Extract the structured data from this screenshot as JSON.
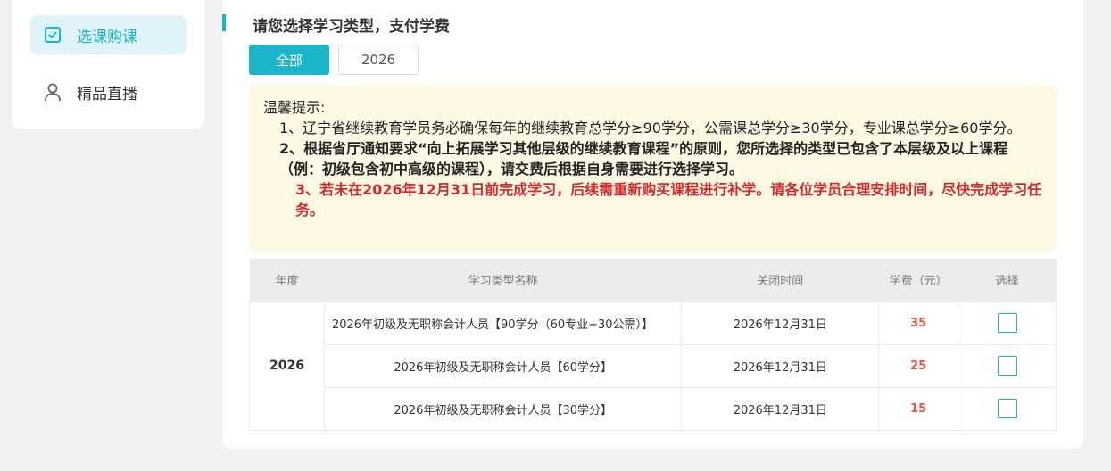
{
  "sidebar": {
    "items": [
      {
        "label": "选课购课",
        "icon": "checkbox-icon",
        "active": true
      },
      {
        "label": "精品直播",
        "icon": "user-icon",
        "active": false
      }
    ]
  },
  "main": {
    "title": "请您选择学习类型，支付学费",
    "tabs": [
      {
        "label": "全部",
        "active": true
      },
      {
        "label": "2026",
        "active": false
      }
    ],
    "notice": {
      "heading": "温馨提示:",
      "line1": "1、辽宁省继续教育学员务必确保每年的继续教育总学分≥90学分，公需课总学分≥30学分，专业课总学分≥60学分。",
      "line2": "2、根据省厅通知要求“向上拓展学习其他层级的继续教育课程”的原则，您所选择的类型已包含了本层级及以上课程（例：初级包含初中高级的课程），请交费后根据自身需要进行选择学习。",
      "line3": "3、若未在2026年12月31日前完成学习，后续需重新购买课程进行补学。请各位学员合理安排时间，尽快完成学习任务。"
    },
    "table": {
      "headers": [
        "年度",
        "学习类型名称",
        "关闭时间",
        "学费（元）",
        "选择"
      ],
      "year": "2026",
      "rows": [
        {
          "name": "2026年初级及无职称会计人员【90学分（60专业+30公需）】",
          "close": "2026年12月31日",
          "fee": "35"
        },
        {
          "name": "2026年初级及无职称会计人员【60学分】",
          "close": "2026年12月31日",
          "fee": "25"
        },
        {
          "name": "2026年初级及无职称会计人员【30学分】",
          "close": "2026年12月31日",
          "fee": "15"
        }
      ]
    }
  },
  "colors": {
    "accent": "#1ab5c9",
    "fee": "#e8543e",
    "warning": "#d42a2a",
    "notice_bg": "#fef9e4"
  }
}
